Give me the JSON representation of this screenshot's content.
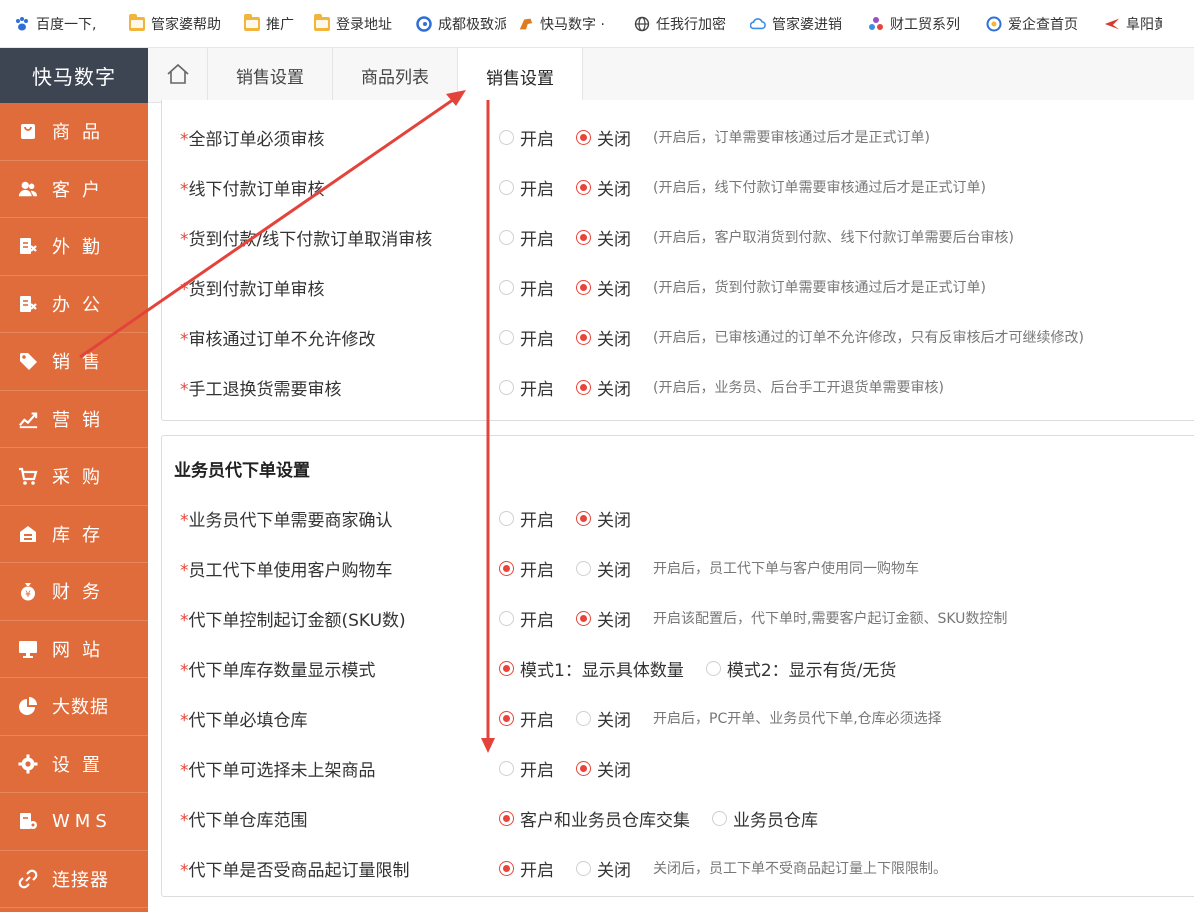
{
  "bookmarks": [
    {
      "label": "百度一下,",
      "icon": "baidu-paw-icon",
      "color": "#2f6fd6"
    },
    {
      "label": "管家婆帮助",
      "icon": "folder-icon"
    },
    {
      "label": "推广",
      "icon": "folder-icon"
    },
    {
      "label": "登录地址",
      "icon": "folder-icon"
    },
    {
      "label": "成都极致派",
      "icon": "swirl-icon",
      "color": "#2f6fd6"
    },
    {
      "label": "快马数字 ·",
      "icon": "horse-icon",
      "color": "#e07a1f"
    },
    {
      "label": "任我行加密",
      "icon": "globe-icon",
      "color": "#444444"
    },
    {
      "label": "管家婆进销",
      "icon": "cloud-icon",
      "color": "#3a8ee6"
    },
    {
      "label": "财工贸系列",
      "icon": "cube-icon",
      "color": "#9b4dca"
    },
    {
      "label": "爱企查首页",
      "icon": "aiqicha-icon",
      "color": "#2f6fd6"
    },
    {
      "label": "阜阳黄页",
      "icon": "bird-icon",
      "color": "#d93a2b"
    }
  ],
  "brand": "快马数字",
  "nav": [
    {
      "label": "商品",
      "icon": "bag-icon"
    },
    {
      "label": "客户",
      "icon": "users-icon"
    },
    {
      "label": "外勤",
      "icon": "field-doc-icon"
    },
    {
      "label": "办公",
      "icon": "office-doc-icon"
    },
    {
      "label": "销售",
      "icon": "tag-icon"
    },
    {
      "label": "营销",
      "icon": "trend-chart-icon"
    },
    {
      "label": "采购",
      "icon": "cart-icon"
    },
    {
      "label": "库存",
      "icon": "warehouse-icon"
    },
    {
      "label": "财务",
      "icon": "money-bag-icon"
    },
    {
      "label": "网站",
      "icon": "monitor-icon"
    },
    {
      "label": "大数据",
      "icon": "pie-chart-icon"
    },
    {
      "label": "设置",
      "icon": "gear-icon"
    },
    {
      "label": "WMS",
      "icon": "wms-icon"
    },
    {
      "label": "连接器",
      "icon": "link-icon"
    }
  ],
  "tabs": [
    {
      "label": "销售设置",
      "active": false
    },
    {
      "label": "商品列表",
      "active": false
    },
    {
      "label": "销售设置",
      "active": true
    }
  ],
  "section1": {
    "rows": [
      {
        "label": "全部订单必须审核",
        "options": [
          {
            "label": "开启",
            "selected": false
          },
          {
            "label": "关闭",
            "selected": true
          }
        ],
        "hint": "(开启后，订单需要审核通过后才是正式订单)"
      },
      {
        "label": "线下付款订单审核",
        "options": [
          {
            "label": "开启",
            "selected": false
          },
          {
            "label": "关闭",
            "selected": true
          }
        ],
        "hint": "(开启后，线下付款订单需要审核通过后才是正式订单)"
      },
      {
        "label": "货到付款/线下付款订单取消审核",
        "options": [
          {
            "label": "开启",
            "selected": false
          },
          {
            "label": "关闭",
            "selected": true
          }
        ],
        "hint": "(开启后，客户取消货到付款、线下付款订单需要后台审核)"
      },
      {
        "label": "货到付款订单审核",
        "options": [
          {
            "label": "开启",
            "selected": false
          },
          {
            "label": "关闭",
            "selected": true
          }
        ],
        "hint": "(开启后，货到付款订单需要审核通过后才是正式订单)"
      },
      {
        "label": "审核通过订单不允许修改",
        "options": [
          {
            "label": "开启",
            "selected": false
          },
          {
            "label": "关闭",
            "selected": true
          }
        ],
        "hint": "(开启后，已审核通过的订单不允许修改，只有反审核后才可继续修改)"
      },
      {
        "label": "手工退换货需要审核",
        "options": [
          {
            "label": "开启",
            "selected": false
          },
          {
            "label": "关闭",
            "selected": true
          }
        ],
        "hint": "(开启后，业务员、后台手工开退货单需要审核)"
      }
    ]
  },
  "section2": {
    "title": "业务员代下单设置",
    "rows": [
      {
        "label": "业务员代下单需要商家确认",
        "options": [
          {
            "label": "开启",
            "selected": false
          },
          {
            "label": "关闭",
            "selected": true
          }
        ],
        "hint": ""
      },
      {
        "label": "员工代下单使用客户购物车",
        "options": [
          {
            "label": "开启",
            "selected": true
          },
          {
            "label": "关闭",
            "selected": false
          }
        ],
        "hint": "开启后，员工代下单与客户使用同一购物车"
      },
      {
        "label": "代下单控制起订金额(SKU数)",
        "options": [
          {
            "label": "开启",
            "selected": false
          },
          {
            "label": "关闭",
            "selected": true
          }
        ],
        "hint": "开启该配置后，代下单时,需要客户起订金额、SKU数控制"
      },
      {
        "label": "代下单库存数量显示模式",
        "options": [
          {
            "label": "模式1：显示具体数量",
            "selected": true
          },
          {
            "label": "模式2：显示有货/无货",
            "selected": false
          }
        ],
        "hint": ""
      },
      {
        "label": "代下单必填仓库",
        "options": [
          {
            "label": "开启",
            "selected": true
          },
          {
            "label": "关闭",
            "selected": false
          }
        ],
        "hint": "开启后，PC开单、业务员代下单,仓库必须选择"
      },
      {
        "label": "代下单可选择未上架商品",
        "options": [
          {
            "label": "开启",
            "selected": false
          },
          {
            "label": "关闭",
            "selected": true
          }
        ],
        "hint": ""
      },
      {
        "label": "代下单仓库范围",
        "options": [
          {
            "label": "客户和业务员仓库交集",
            "selected": true
          },
          {
            "label": "业务员仓库",
            "selected": false
          }
        ],
        "hint": ""
      },
      {
        "label": "代下单是否受商品起订量限制",
        "options": [
          {
            "label": "开启",
            "selected": true
          },
          {
            "label": "关闭",
            "selected": false
          }
        ],
        "hint": "关闭后，员工下单不受商品起订量上下限限制。"
      }
    ]
  },
  "colors": {
    "sidebar": "#e06c3c",
    "brand_bg": "#3d4452",
    "accent": "#e8443a",
    "annotation": "#e4433b"
  }
}
